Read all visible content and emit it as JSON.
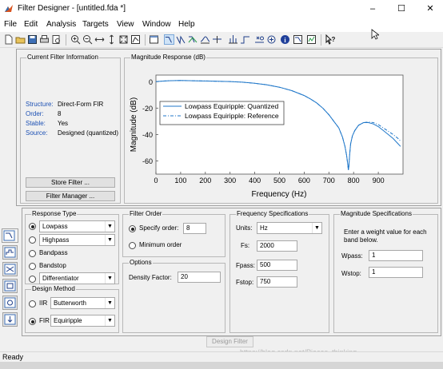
{
  "window": {
    "title": "Filter Designer - [untitled.fda *]",
    "minimize_glyph": "–",
    "maximize_glyph": "☐",
    "close_glyph": "✕"
  },
  "menu": [
    "File",
    "Edit",
    "Analysis",
    "Targets",
    "View",
    "Window",
    "Help"
  ],
  "current_filter": {
    "title": "Current Filter Information",
    "structure_label": "Structure:",
    "structure_value": "Direct-Form FIR",
    "order_label": "Order:",
    "order_value": "8",
    "stable_label": "Stable:",
    "stable_value": "Yes",
    "source_label": "Source:",
    "source_value": "Designed (quantized)",
    "store_button": "Store Filter ...",
    "manager_button": "Filter Manager ..."
  },
  "magnitude_panel": {
    "title": "Magnitude Response (dB)"
  },
  "chart_data": {
    "type": "line",
    "xlabel": "Frequency (Hz)",
    "ylabel": "Magnitude (dB)",
    "xlim": [
      0,
      1000
    ],
    "ylim": [
      -70,
      5
    ],
    "xticks": [
      0,
      100,
      200,
      300,
      400,
      500,
      600,
      700,
      800,
      900
    ],
    "yticks": [
      0,
      -20,
      -40,
      -60
    ],
    "grid": false,
    "legend_position": "upper-left",
    "series": [
      {
        "name": "Lowpass Equiripple: Quantized",
        "style": "solid",
        "color": "#1f77c9",
        "x": [
          0,
          50,
          100,
          150,
          200,
          250,
          300,
          350,
          400,
          450,
          500,
          550,
          600,
          625,
          650,
          675,
          700,
          720,
          740,
          755,
          765,
          772,
          776,
          779,
          781,
          784,
          788,
          795,
          805,
          820,
          840,
          860,
          880,
          900,
          920,
          940,
          960,
          980,
          990
        ],
        "y": [
          0.1,
          0.7,
          0.9,
          0.7,
          0.5,
          0.3,
          0.1,
          -0.4,
          -1.2,
          -2.4,
          -4.2,
          -6.8,
          -10.5,
          -13,
          -16,
          -20,
          -25,
          -30,
          -35,
          -42,
          -49,
          -56,
          -62,
          -67,
          -64,
          -55,
          -47,
          -41,
          -37,
          -33,
          -31,
          -31,
          -32,
          -34,
          -37,
          -40,
          -43,
          -47,
          -49
        ]
      },
      {
        "name": "Lowpass Equiripple: Reference",
        "style": "dash-dot",
        "color": "#1f77c9",
        "x": [
          0,
          50,
          100,
          150,
          200,
          250,
          300,
          350,
          400,
          450,
          500,
          550,
          600,
          625,
          650,
          675,
          700,
          720,
          740,
          755,
          765,
          772,
          776,
          779,
          781,
          784,
          788,
          795,
          805,
          820,
          840,
          860,
          880,
          900,
          920,
          940,
          960,
          980,
          990
        ],
        "y": [
          0.1,
          0.7,
          0.9,
          0.7,
          0.5,
          0.3,
          0.1,
          -0.4,
          -1.2,
          -2.4,
          -4.2,
          -6.8,
          -10.5,
          -13,
          -16,
          -20,
          -25,
          -30,
          -35,
          -42,
          -49,
          -56,
          -62,
          -67,
          -64,
          -55,
          -47,
          -41,
          -37,
          -33,
          -31,
          -30.5,
          -31,
          -32.5,
          -35,
          -37.5,
          -40,
          -43,
          -45
        ]
      }
    ]
  },
  "response_type": {
    "title": "Response Type",
    "lowpass": "Lowpass",
    "highpass": "Highpass",
    "bandpass": "Bandpass",
    "bandstop": "Bandstop",
    "differentiator": "Differentiator"
  },
  "design_method": {
    "title": "Design Method",
    "iir_label": "IIR",
    "iir_value": "Butterworth",
    "fir_label": "FIR",
    "fir_value": "Equiripple"
  },
  "filter_order": {
    "title": "Filter Order",
    "specify_label": "Specify order:",
    "specify_value": "8",
    "minimum_label": "Minimum order"
  },
  "options": {
    "title": "Options",
    "density_label": "Density Factor:",
    "density_value": "20"
  },
  "freq_specs": {
    "title": "Frequency Specifications",
    "units_label": "Units:",
    "units_value": "Hz",
    "fs_label": "Fs:",
    "fs_value": "2000",
    "fpass_label": "Fpass:",
    "fpass_value": "500",
    "fstop_label": "Fstop:",
    "fstop_value": "750"
  },
  "mag_specs": {
    "title": "Magnitude Specifications",
    "description": "Enter a weight value for each band below.",
    "wpass_label": "Wpass:",
    "wpass_value": "1",
    "wstop_label": "Wstop:",
    "wstop_value": "1"
  },
  "design_button": "Design Filter",
  "status": "Ready",
  "watermark": "https://blog.csdn.net/Pieces_thinking",
  "colors": {
    "accent": "#1f77c9",
    "label_blue": "#1c50b4"
  }
}
